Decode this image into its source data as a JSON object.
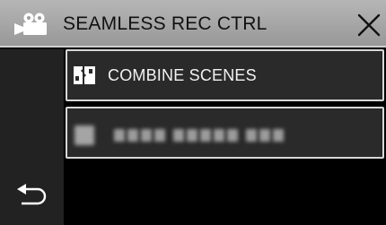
{
  "header": {
    "title": "SEAMLESS REC CTRL",
    "mode_icon": "camcorder-icon",
    "close_icon": "close-icon"
  },
  "sidebar": {
    "back_icon": "back-arrow-icon"
  },
  "menu": {
    "items": [
      {
        "label": "COMBINE SCENES",
        "icon": "combine-scenes-icon"
      },
      {
        "label": "",
        "icon": "blurred-icon",
        "note_visible": "obscured item"
      }
    ]
  },
  "colors": {
    "title_bar": "#a8a8a8",
    "side_panel": "#222222",
    "item_bg": "#2a2a2a",
    "item_border": "#d8d8d8",
    "text": "#f2f2f2"
  }
}
